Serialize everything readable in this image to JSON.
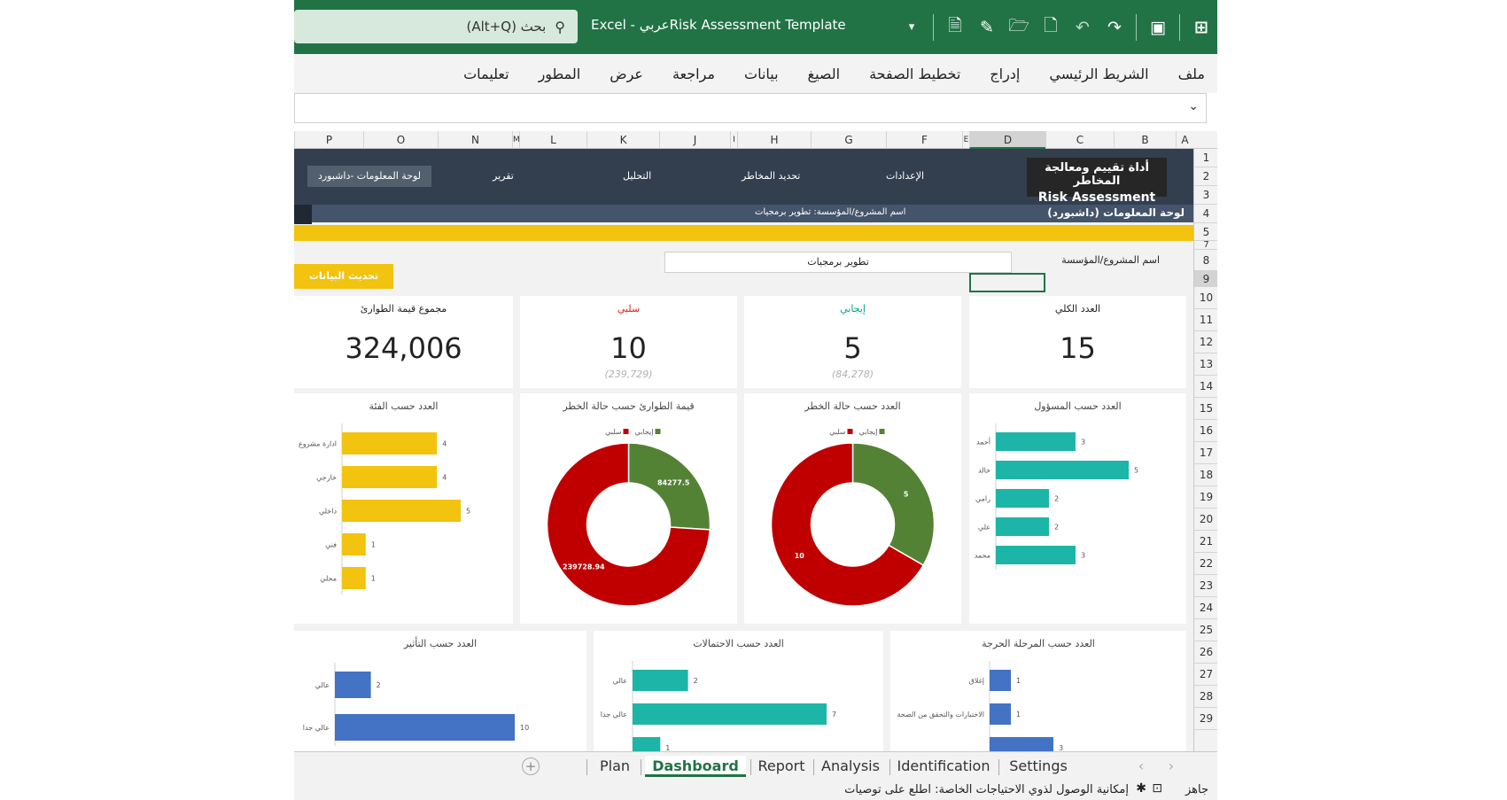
{
  "titlebar": {
    "search_label": "بحث (Alt+Q)",
    "window_title": "Excel  -  عربيRisk Assessment Template"
  },
  "ribbon_tabs": [
    "ملف",
    "الشريط الرئيسي",
    "إدراج",
    "تخطيط الصفحة",
    "الصيغ",
    "بيانات",
    "مراجعة",
    "عرض",
    "المطور",
    "تعليمات"
  ],
  "columns": [
    "A",
    "B",
    "C",
    "D",
    "E",
    "F",
    "G",
    "H",
    "I",
    "J",
    "K",
    "L",
    "M",
    "N",
    "O",
    "P"
  ],
  "rows": [
    "1",
    "2",
    "3",
    "4",
    "5",
    "7",
    "8",
    "9",
    "10",
    "11",
    "12",
    "13",
    "14",
    "15",
    "16",
    "17",
    "18",
    "19",
    "20",
    "21",
    "22",
    "23",
    "24",
    "25",
    "26",
    "27",
    "28",
    "29"
  ],
  "nav": {
    "brand_line1": "أداة تقييم ومعالجة المخاطر",
    "brand_line2": "Risk Assessment",
    "settings": "الإعدادات",
    "identification": "تحديد المخاطر",
    "analysis": "التحليل",
    "report": "تقرير",
    "dashboard": "لوحة المعلومات -داشبورد"
  },
  "subbar": {
    "title": "لوحة المعلومات (داشبورد)",
    "project": "اسم المشروع/المؤسسة:  تطوير برمجيات"
  },
  "form": {
    "project_label": "اسم المشروع/المؤسسة",
    "project_value": "تطوير برمجيات",
    "refresh_button": "تحديث البيانات"
  },
  "kpis": {
    "total": {
      "label": "العدد الكلي",
      "value": "15",
      "sub": ""
    },
    "positive": {
      "label": "إيجابي",
      "value": "5",
      "sub": "(84,278)"
    },
    "negative": {
      "label": "سلبي",
      "value": "10",
      "sub": "(239,729)"
    },
    "contingency": {
      "label": "مجموع قيمة الطوارئ",
      "value": "324,006",
      "sub": ""
    }
  },
  "colors": {
    "teal": "#1cb5a7",
    "yellow": "#f2c30f",
    "blue": "#4472c4",
    "green": "#548235",
    "red": "#c00000",
    "positive_text": "#00a388",
    "negative_text": "#e02020"
  },
  "chart_data": [
    {
      "type": "bar",
      "orientation": "horizontal",
      "title": "العدد حسب المسؤول",
      "categories": [
        "أحمد",
        "خالد",
        "رامي",
        "علي",
        "محمد"
      ],
      "values": [
        3,
        5,
        2,
        2,
        3
      ],
      "color": "teal"
    },
    {
      "type": "pie",
      "donut": true,
      "title": "العدد حسب حالة الخطر",
      "legend": [
        "سلبي",
        "إيجابي"
      ],
      "categories": [
        "إيجابي",
        "سلبي"
      ],
      "values": [
        5,
        10
      ],
      "labels": [
        "5",
        "10"
      ]
    },
    {
      "type": "pie",
      "donut": true,
      "title": "قيمة الطوارئ حسب حالة الخطر",
      "legend": [
        "سلبي",
        "إيجابي"
      ],
      "categories": [
        "إيجابي",
        "سلبي"
      ],
      "values": [
        84277.5,
        239728.94
      ],
      "labels": [
        "84277.5",
        "239728.94"
      ]
    },
    {
      "type": "bar",
      "orientation": "horizontal",
      "title": "العدد حسب الفئة",
      "categories": [
        "ادارة مشروع",
        "خارجي",
        "داخلي",
        "فني",
        "محلي"
      ],
      "values": [
        4,
        4,
        5,
        1,
        1
      ],
      "color": "yellow"
    },
    {
      "type": "bar",
      "orientation": "horizontal",
      "title": "العدد حسب المرحلة الحرجة",
      "categories": [
        "إغلاق",
        "الاختبارات والتحقق من الصحة",
        ""
      ],
      "values": [
        1,
        1,
        3
      ],
      "color": "blue"
    },
    {
      "type": "bar",
      "orientation": "horizontal",
      "title": "العدد حسب الاحتمالات",
      "categories": [
        "عالي",
        "عالي جدا",
        ""
      ],
      "values": [
        2,
        7,
        1
      ],
      "color": "teal"
    },
    {
      "type": "bar",
      "orientation": "horizontal",
      "title": "العدد حسب التأثير",
      "categories": [
        "عالي",
        "عالي جدا"
      ],
      "values": [
        2,
        10
      ],
      "color": "blue"
    }
  ],
  "sheet_tabs": [
    "Plan",
    "Dashboard",
    "Report",
    "Analysis",
    "Identification",
    "Settings"
  ],
  "active_sheet": "Dashboard",
  "status": {
    "ready": "جاهز",
    "accessibility": "إمكانية الوصول لذوي الاحتياجات الخاصة: اطلع على توصيات"
  }
}
